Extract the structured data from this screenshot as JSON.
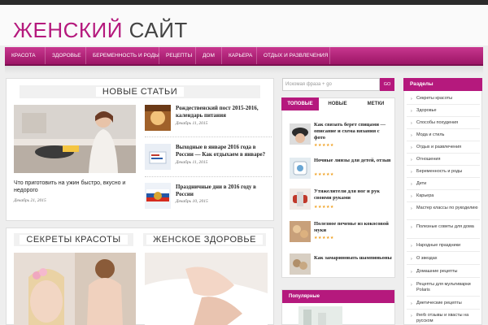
{
  "site": {
    "title_part1": "ЖЕНСКИЙ",
    "title_part2": "САЙТ"
  },
  "nav": [
    "КРАСОТА",
    "ЗДОРОВЬЕ",
    "БЕРЕМЕННОСТЬ И РОДЫ",
    "РЕЦЕПТЫ",
    "ДОМ",
    "КАРЬЕРА",
    "ОТДЫХ И РАЗВЛЕЧЕНИЯ"
  ],
  "new_articles": {
    "title": "НОВЫЕ СТАТЬИ",
    "main_title": "Что приготовить на ужин быстро, вкусно и недорого",
    "main_date": "Декабрь 21, 2015",
    "items": [
      {
        "title": "Рождественский пост 2015-2016, календарь питания",
        "date": "Декабрь 11, 2015"
      },
      {
        "title": "Выходные в январе 2016 года в России — Как отдыхаем в январе?",
        "date": "Декабрь 11, 2015"
      },
      {
        "title": "Праздничные дни в 2016 году в России",
        "date": "Декабрь 10, 2015"
      }
    ]
  },
  "beauty": {
    "title": "СЕКРЕТЫ КРАСОТЫ"
  },
  "health": {
    "title": "ЖЕНСКОЕ ЗДОРОВЬЕ"
  },
  "search": {
    "placeholder": "Искомая фраза + go",
    "button": "GO"
  },
  "tabs": [
    "ТОПОВЫЕ",
    "НОВЫЕ",
    "МЕТКИ"
  ],
  "popular_list": [
    {
      "title": "Как связать берет спицами — описание и схема вязания с фото",
      "rating": "★★★★★"
    },
    {
      "title": "Ночные линзы для детей, отзыв",
      "rating": "★★★★★"
    },
    {
      "title": "Утяжелители для ног и рук своими руками",
      "rating": "★★★★★"
    },
    {
      "title": "Полезное печенье из кокосовой муки",
      "rating": "★★★★★"
    },
    {
      "title": "Как замариновать шампиньоны",
      "rating": "★★★★★"
    }
  ],
  "popular_box": {
    "title": "Популярные"
  },
  "categories": {
    "title": "Разделы",
    "items": [
      "Секреты красоты",
      "Здоровье",
      "Способы похудения",
      "Мода и стиль",
      "Отдых и развлечения",
      "Отношения",
      "Беременность и роды",
      "Дети",
      "Карьера",
      "Мастер классы по рукоделию",
      "Полезные советы для дома",
      "Народные праздники",
      "О звездах",
      "Домашние рецепты",
      "Рецепты для мультиварки Polaris",
      "Диетические рецепты",
      "iherb отзывы и хваcты на русском"
    ]
  },
  "colors": {
    "accent": "#b5197d",
    "nav": "#a81a6e"
  }
}
